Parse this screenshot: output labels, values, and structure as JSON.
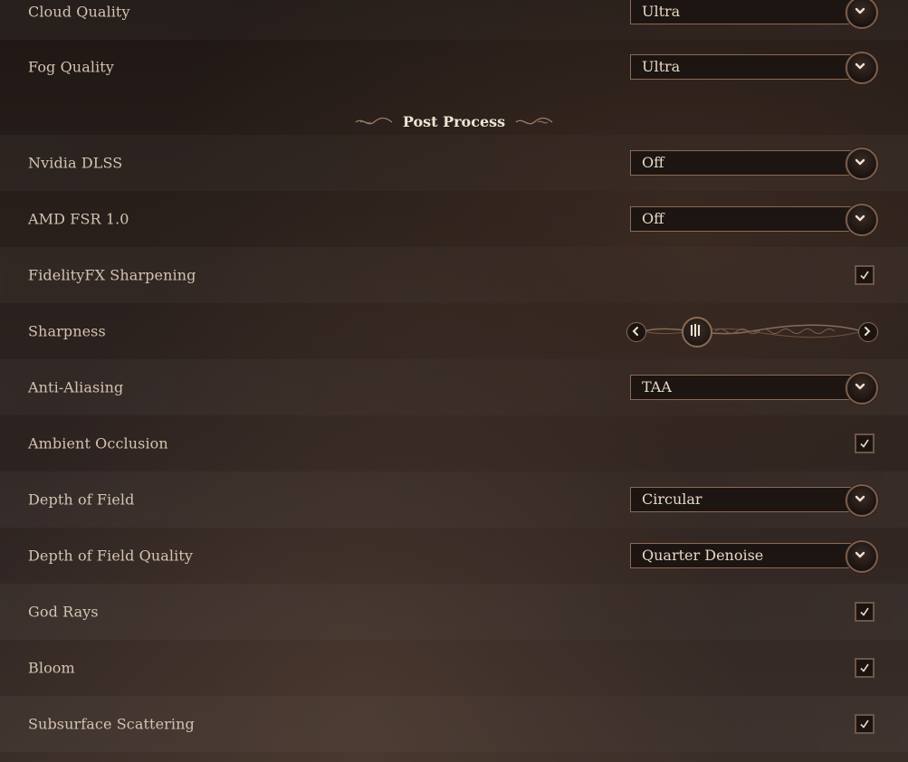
{
  "section_title": "Post Process",
  "rows": [
    {
      "label": "Cloud Quality",
      "control": "dropdown",
      "value": "Ultra"
    },
    {
      "label": "Fog Quality",
      "control": "dropdown",
      "value": "Ultra"
    },
    {
      "label": "Nvidia DLSS",
      "control": "dropdown",
      "value": "Off"
    },
    {
      "label": "AMD FSR 1.0",
      "control": "dropdown",
      "value": "Off"
    },
    {
      "label": "FidelityFX Sharpening",
      "control": "checkbox",
      "checked": true
    },
    {
      "label": "Sharpness",
      "control": "slider",
      "level": 0.2
    },
    {
      "label": "Anti-Aliasing",
      "control": "dropdown",
      "value": "TAA"
    },
    {
      "label": "Ambient Occlusion",
      "control": "checkbox",
      "checked": true
    },
    {
      "label": "Depth of Field",
      "control": "dropdown",
      "value": "Circular"
    },
    {
      "label": "Depth of Field Quality",
      "control": "dropdown",
      "value": "Quarter Denoise"
    },
    {
      "label": "God Rays",
      "control": "checkbox",
      "checked": true
    },
    {
      "label": "Bloom",
      "control": "checkbox",
      "checked": true
    },
    {
      "label": "Subsurface Scattering",
      "control": "checkbox",
      "checked": true
    }
  ]
}
